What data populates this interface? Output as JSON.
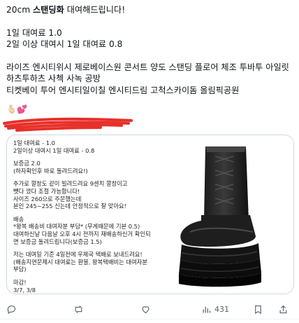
{
  "post": {
    "line1_prefix": "20cm ",
    "line1_bold": "스탠딩화",
    "line1_suffix": " 대여해드립니다!",
    "price1": "1일 대여료 1.0",
    "price2": "2일 이상 대여시 1일 대여료 0.8",
    "venues1": "라이즈 엔시티위시 제로베이스원 콘서트 양도 스탠딩 플로어 체조 투바투 아일릿 하츠투하츠 사첵 사녹 공방",
    "venues2": "티켓베이 투어 엔시티일이칠 엔시티드림 고척스카이돔 올림픽공원",
    "emojis": "🫰🏻💕"
  },
  "card": {
    "lines": [
      "1일 대여료 - 1.0",
      "2일이상 대여시 1일 대여료 - 0.8",
      "",
      "보증금 2.0",
      "(하자확인후 바로 돌려드려요!)",
      "",
      "추가로 깔창도 같이 빌려드려요 9센치 깔창이고",
      "뺏다 꼈다 조절 가능합니다!",
      "사이즈 260으로 주문했는데",
      "본인 245~255 신는데 안정적으로 잘 맞아요!",
      "",
      "배송",
      "*왕복 배송비 대여자분 부담* (무게때문에 기본 0.5)",
      "대여하신날 다음날 오후 4시 전까지 재배송하신거 확인되",
      "면 보증금 돌려드립니다(보증금 1.5)",
      "",
      "저는 대여일 기준 4일전에 우체국 택배로 보내드려요!",
      "(배송지연문제시 대여료는 환불, 왕복택배비는 대여자분",
      "부담)",
      "",
      "마감!",
      "3/7, 3/8"
    ],
    "image_alt": "black-platform-boot"
  },
  "actions": {
    "views": "431"
  },
  "colors": {
    "text": "#0f1419",
    "muted": "#536471",
    "border": "#cfd9de",
    "redact": "#e8302a"
  }
}
